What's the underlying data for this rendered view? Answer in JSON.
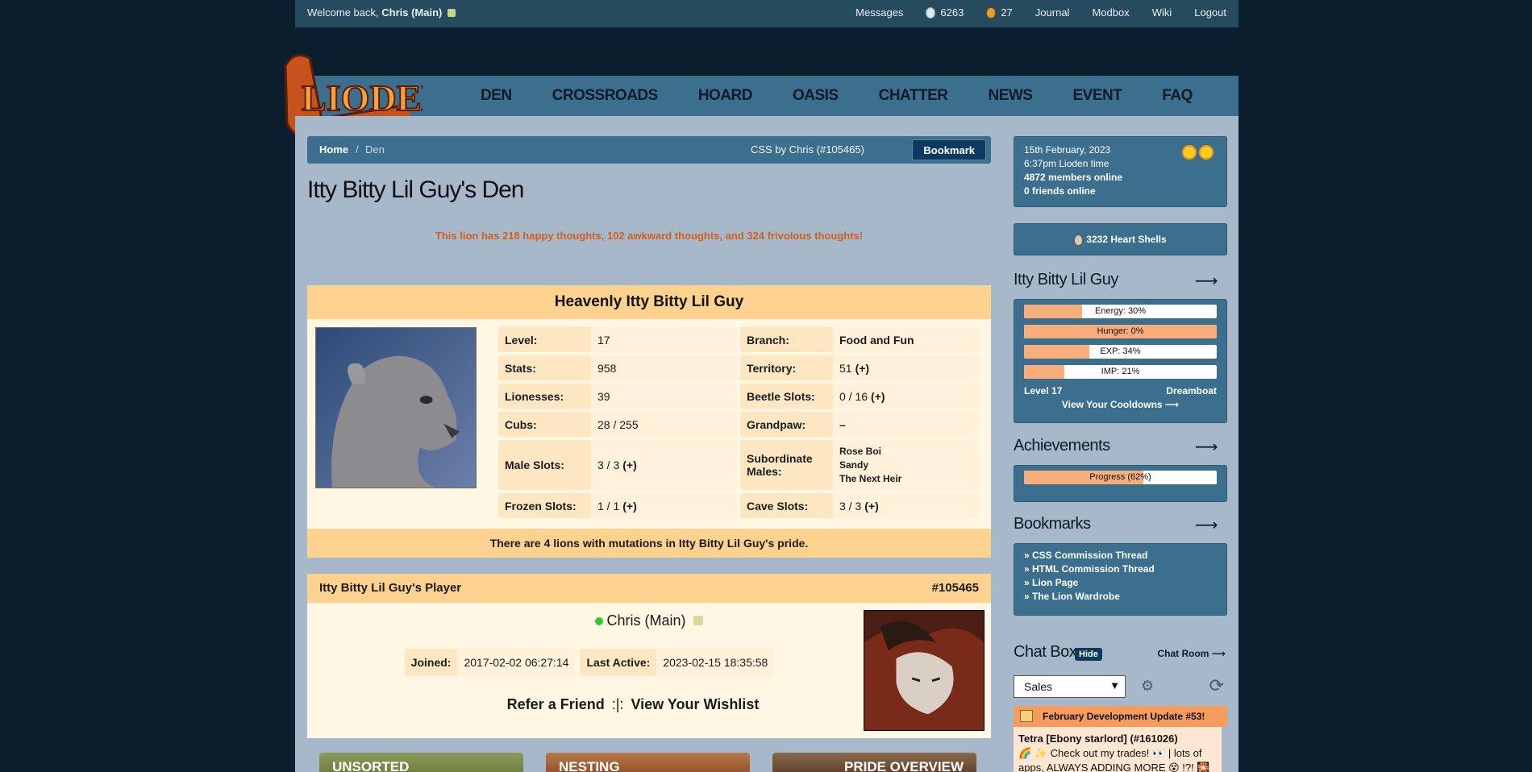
{
  "topbar": {
    "welcome_prefix": "Welcome back,",
    "user": "Chris (Main)",
    "messages": "Messages",
    "currency1": "6263",
    "currency2": "27",
    "journal": "Journal",
    "modbox": "Modbox",
    "wiki": "Wiki",
    "logout": "Logout"
  },
  "logo": {
    "text": "LIODEN"
  },
  "nav": [
    "DEN",
    "CROSSROADS",
    "HOARD",
    "OASIS",
    "CHATTER",
    "NEWS",
    "EVENT",
    "FAQ"
  ],
  "breadcrumb": {
    "home": "Home",
    "sep": "/",
    "current": "Den",
    "css_credit": "CSS by Chris (#105465)",
    "bookmark": "Bookmark"
  },
  "den": {
    "title": "Itty Bitty Lil Guy's Den",
    "thoughts": "This lion has 218 happy thoughts, 102 awkward thoughts, and 324 frivolous thoughts!"
  },
  "lion": {
    "header": "Heavenly Itty Bitty Lil Guy",
    "plus": "(+)",
    "stats": {
      "level_k": "Level:",
      "level_v": "17",
      "branch_k": "Branch:",
      "branch_v": "Food and Fun",
      "stats_k": "Stats:",
      "stats_v": "958",
      "territory_k": "Territory:",
      "territory_v": "51",
      "lionesses_k": "Lionesses:",
      "lionesses_v": "39",
      "beetle_k": "Beetle Slots:",
      "beetle_v": "0 / 16",
      "cubs_k": "Cubs:",
      "cubs_v": "28 / 255",
      "grandpaw_k": "Grandpaw:",
      "grandpaw_v": "–",
      "male_k": "Male Slots:",
      "male_v": "3 / 3",
      "sub_k": "Subordinate Males:",
      "sub_v": [
        "Rose Boi",
        "Sandy",
        "The Next Heir"
      ],
      "frozen_k": "Frozen Slots:",
      "frozen_v": "1 / 1",
      "cave_k": "Cave Slots:",
      "cave_v": "3 / 3"
    },
    "footer": "There are 4 lions with mutations in Itty Bitty Lil Guy's pride."
  },
  "player": {
    "header": "Itty Bitty Lil Guy's Player",
    "id": "#105465",
    "name": "Chris (Main)",
    "joined_k": "Joined:",
    "joined_v": "2017-02-02 06:27:14",
    "active_k": "Last Active:",
    "active_v": "2023-02-15 18:35:58",
    "refer": "Refer a Friend",
    "sep": ":|:",
    "wishlist": "View Your Wishlist"
  },
  "tiles": [
    "UNSORTED",
    "NESTING",
    "PRIDE OVERVIEW"
  ],
  "sidebar": {
    "date": "15th February, 2023",
    "time": "6:37pm Lioden time",
    "members": "4872 members online",
    "friends": "0 friends online",
    "heart_shells": "3232 Heart Shells",
    "lion_heading": "Itty Bitty Lil Guy",
    "arrow": "⟶",
    "bars": [
      {
        "label": "Energy: 30%",
        "value": 0.3
      },
      {
        "label": "Hunger: 0%",
        "value": 1.0
      },
      {
        "label": "EXP: 34%",
        "value": 0.34
      },
      {
        "label": "IMP: 21%",
        "value": 0.21
      }
    ],
    "level": "Level 17",
    "mood": "Dreamboat",
    "cooldowns": "View Your Cooldowns ⟶",
    "achievements_heading": "Achievements",
    "progress_label": "Progress (62%)",
    "progress_value": 0.62,
    "bookmarks_heading": "Bookmarks",
    "bookmarks": [
      "» CSS Commission Thread",
      "» HTML Commission Thread",
      "» Lion Page",
      "» The Lion Wardrobe"
    ],
    "chat_heading": "Chat Box",
    "hide": "Hide",
    "chat_room": "Chat Room ⟶",
    "chat_channel": "Sales",
    "announce": "February Development Update #53! [link]",
    "chat_user": "Tetra [Ebony starlord] (#161026)",
    "chat_text": "🌈 ✨ Check out my trades! 👀 | lots of apps, ALWAYS ADDING MORE 😵 !?! 🎇 🎉"
  },
  "colors": {
    "accent": "#3c6f8d",
    "panel": "#fff6e4",
    "panel_header": "#fdd18e",
    "thoughts": "#d35f1c"
  }
}
